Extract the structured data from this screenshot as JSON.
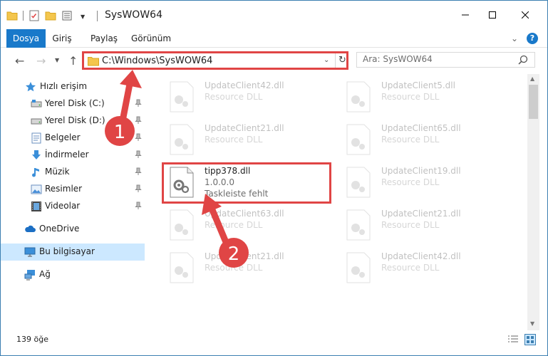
{
  "window": {
    "title": "SysWOW64",
    "minimize_symbol": "—",
    "maximize_symbol": "☐",
    "close_symbol": "✕"
  },
  "ribbon": {
    "tabs": [
      {
        "label": "Dosya"
      },
      {
        "label": "Giriş"
      },
      {
        "label": "Paylaş"
      },
      {
        "label": "Görünüm"
      }
    ],
    "help_label": "?"
  },
  "address": {
    "path": "C:\\Windows\\SysWOW64",
    "search_placeholder": "Ara: SysWOW64"
  },
  "sidebar": {
    "items": [
      {
        "label": "Hızlı erişim",
        "icon": "star-icon"
      },
      {
        "label": "Yerel Disk (C:)",
        "icon": "drive-icon"
      },
      {
        "label": "Yerel Disk (D:)",
        "icon": "drive-icon"
      },
      {
        "label": "Belgeler",
        "icon": "documents-icon"
      },
      {
        "label": "İndirmeler",
        "icon": "download-icon"
      },
      {
        "label": "Müzik",
        "icon": "music-icon"
      },
      {
        "label": "Resimler",
        "icon": "pictures-icon"
      },
      {
        "label": "Videolar",
        "icon": "videos-icon"
      },
      {
        "label": "OneDrive",
        "icon": "cloud-icon"
      },
      {
        "label": "Bu bilgisayar",
        "icon": "computer-icon"
      },
      {
        "label": "Ağ",
        "icon": "network-icon"
      }
    ]
  },
  "files": {
    "col1": [
      {
        "name": "UpdateClient42.dll",
        "type": "Resource DLL"
      },
      {
        "name": "UpdateClient21.dll",
        "type": "Resource DLL"
      },
      {
        "name": "tipp378.dll",
        "version": "1.0.0.0",
        "description": "Taskleiste fehlt"
      },
      {
        "name": "UpdateClient63.dll",
        "type": "Resource DLL"
      },
      {
        "name": "UpdateClient21.dll",
        "type": "Resource DLL"
      }
    ],
    "col2": [
      {
        "name": "UpdateClient5.dll",
        "type": "Resource DLL"
      },
      {
        "name": "UpdateClient65.dll",
        "type": "Resource DLL"
      },
      {
        "name": "UpdateClient19.dll",
        "type": "Resource DLL"
      },
      {
        "name": "UpdateClient21.dll",
        "type": "Resource DLL"
      },
      {
        "name": "UpdateClient42.dll",
        "type": "Resource DLL"
      }
    ]
  },
  "status": {
    "item_count": "139 öğe"
  },
  "annotations": {
    "step1": "1",
    "step2": "2",
    "color": "#e04545"
  },
  "colors": {
    "accent": "#1979ca",
    "highlight": "#e04545",
    "selection": "#cce8ff"
  }
}
